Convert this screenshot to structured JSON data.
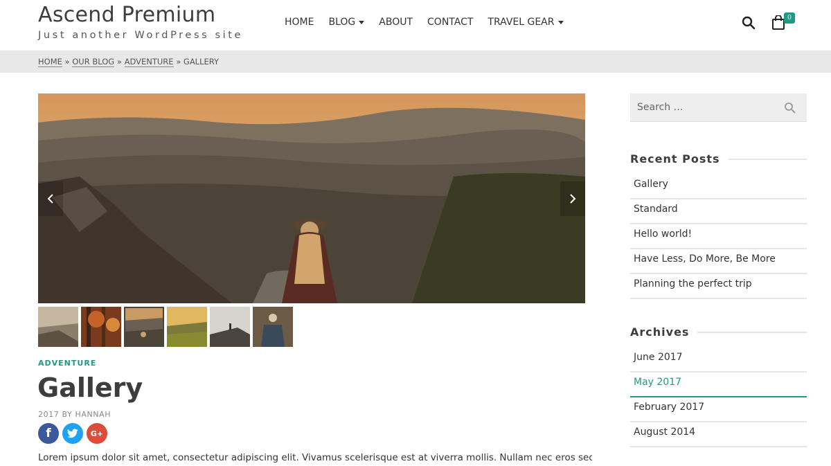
{
  "site": {
    "title": "Ascend Premium",
    "tagline": "Just another WordPress site"
  },
  "nav": {
    "items": [
      {
        "label": "HOME",
        "dropdown": false
      },
      {
        "label": "BLOG",
        "dropdown": true
      },
      {
        "label": "ABOUT",
        "dropdown": false
      },
      {
        "label": "CONTACT",
        "dropdown": false
      },
      {
        "label": "TRAVEL GEAR",
        "dropdown": true
      }
    ],
    "cart_count": "0"
  },
  "breadcrumb": {
    "items": [
      "HOME",
      "OUR BLOG",
      "ADVENTURE"
    ],
    "current": "GALLERY",
    "separator": "»"
  },
  "post": {
    "category": "ADVENTURE",
    "title": "Gallery",
    "meta": "2017 BY HANNAH",
    "excerpt": "Lorem ipsum dolor sit amet, consectetur adipiscing elit. Vivamus scelerisque est at viverra mollis. Nullam nec eros sed",
    "share": [
      {
        "name": "facebook",
        "glyph": "f"
      },
      {
        "name": "twitter",
        "glyph": "t"
      },
      {
        "name": "google-plus",
        "glyph": "G+"
      }
    ]
  },
  "sidebar": {
    "search_placeholder": "Search …",
    "recent_posts": {
      "title": "Recent Posts",
      "items": [
        "Gallery",
        "Standard",
        "Hello world!",
        "Have Less, Do More, Be More",
        "Planning the perfect trip"
      ]
    },
    "archives": {
      "title": "Archives",
      "items": [
        "June 2017",
        "May 2017",
        "February 2017",
        "August 2014"
      ],
      "active_index": 1
    }
  },
  "colors": {
    "accent": "#1e9a85",
    "facebook": "#3b5998",
    "twitter": "#1da1f2",
    "google_plus": "#dd4b39"
  }
}
